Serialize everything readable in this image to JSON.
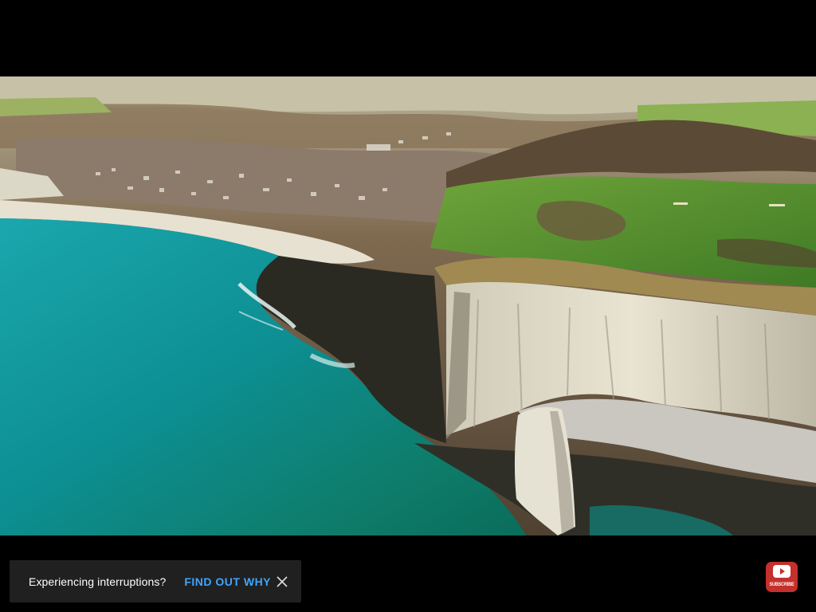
{
  "notification": {
    "message": "Experiencing interruptions?",
    "action_label": "FIND OUT WHY",
    "close_icon": "close-icon",
    "action_color": "#3ea6ff"
  },
  "watermark": {
    "label": "SUBSCRIBE",
    "icon": "youtube-logo-icon",
    "color": "#c4302b"
  },
  "video": {
    "scene": "aerial-coastline-chalk-cliffs"
  }
}
